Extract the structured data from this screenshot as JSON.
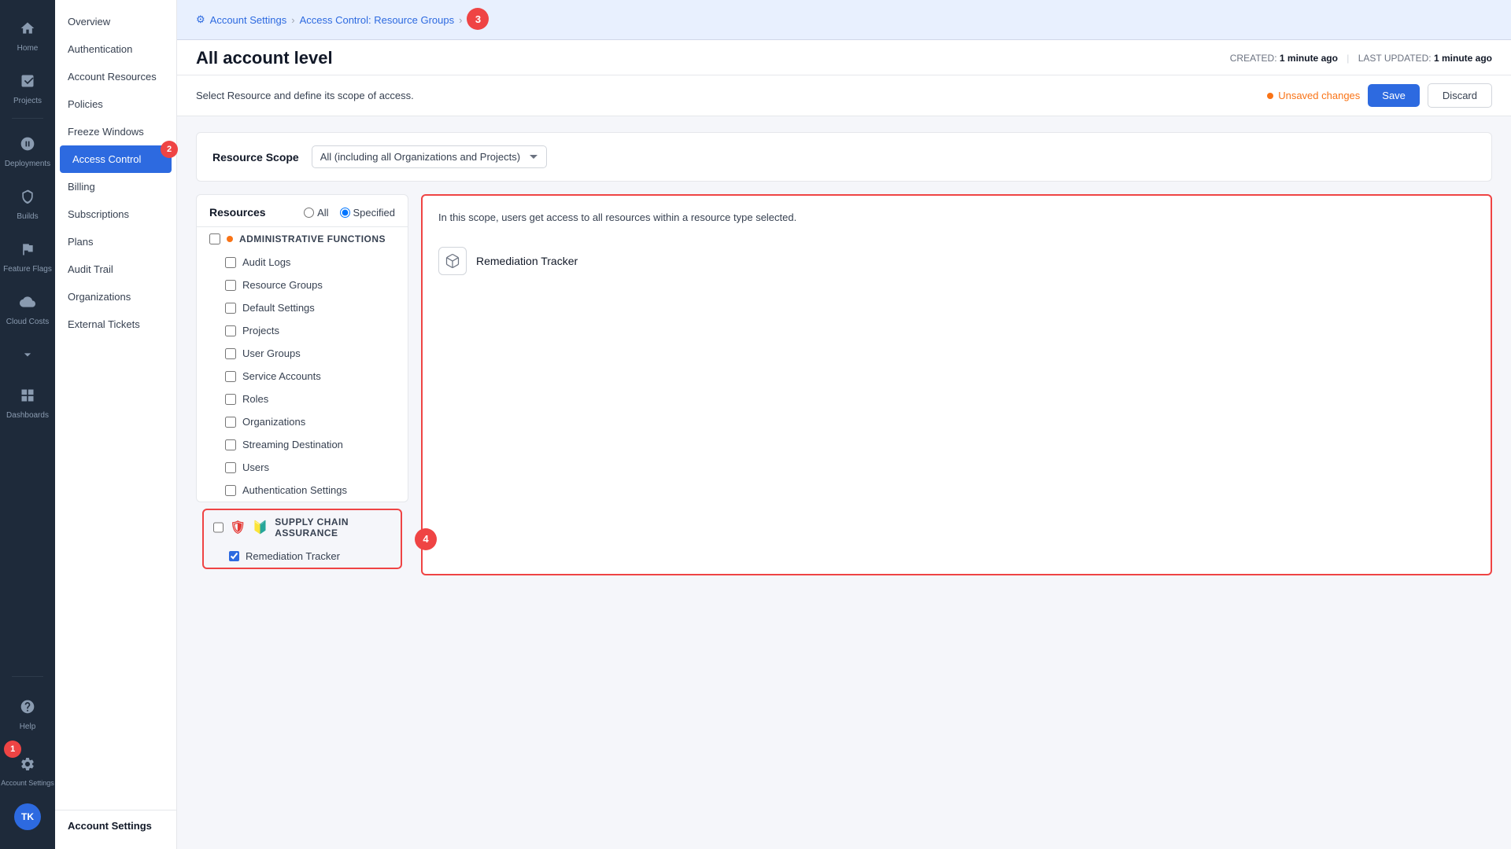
{
  "iconNav": {
    "items": [
      {
        "id": "home",
        "label": "Home",
        "icon": "home",
        "active": false
      },
      {
        "id": "projects",
        "label": "Projects",
        "icon": "projects",
        "active": false
      },
      {
        "id": "deployments",
        "label": "Deployments",
        "icon": "deployments",
        "active": false
      },
      {
        "id": "builds",
        "label": "Builds",
        "icon": "builds",
        "active": false
      },
      {
        "id": "feature-flags",
        "label": "Feature Flags",
        "icon": "flags",
        "active": false
      },
      {
        "id": "cloud-costs",
        "label": "Cloud Costs",
        "icon": "cloud",
        "active": false
      },
      {
        "id": "help",
        "label": "Help",
        "icon": "help",
        "active": false
      },
      {
        "id": "dashboards",
        "label": "Dashboards",
        "icon": "dashboards",
        "active": false
      },
      {
        "id": "account-settings",
        "label": "Account Settings",
        "icon": "gear",
        "active": false
      }
    ]
  },
  "sidebar": {
    "items": [
      {
        "label": "Overview",
        "active": false
      },
      {
        "label": "Authentication",
        "active": false
      },
      {
        "label": "Account Resources",
        "active": false
      },
      {
        "label": "Policies",
        "active": false
      },
      {
        "label": "Freeze Windows",
        "active": false
      },
      {
        "label": "Access Control",
        "active": true
      },
      {
        "label": "Billing",
        "active": false
      },
      {
        "label": "Subscriptions",
        "active": false
      },
      {
        "label": "Plans",
        "active": false
      },
      {
        "label": "Audit Trail",
        "active": false
      },
      {
        "label": "Organizations",
        "active": false
      },
      {
        "label": "External Tickets",
        "active": false
      }
    ],
    "accountTitle": "Account Settings"
  },
  "breadcrumb": {
    "settings": "Account Settings",
    "parent": "Access Control: Resource Groups",
    "current": "3"
  },
  "pageTitle": "All account level",
  "meta": {
    "created": "1 minute ago",
    "lastUpdated": "1 minute ago",
    "createdLabel": "CREATED:",
    "lastUpdatedLabel": "LAST UPDATED:"
  },
  "toolbar": {
    "description": "Select Resource and define its scope of access.",
    "unsavedLabel": "Unsaved changes",
    "saveLabel": "Save",
    "discardLabel": "Discard"
  },
  "resourceScope": {
    "label": "Resource Scope",
    "value": "All (including all Organizations and Projects)"
  },
  "resources": {
    "title": "Resources",
    "radioAll": "All",
    "radioSpecified": "Specified",
    "selectedRadio": "Specified",
    "category": "ADMINISTRATIVE FUNCTIONS",
    "items": [
      "Audit Logs",
      "Resource Groups",
      "Default Settings",
      "Projects",
      "User Groups",
      "Service Accounts",
      "Roles",
      "Organizations",
      "Streaming Destination",
      "Users",
      "Authentication Settings"
    ]
  },
  "supplyChain": {
    "title": "SUPPLY CHAIN ASSURANCE",
    "item": "Remediation Tracker",
    "checked": true
  },
  "scopeInfo": {
    "description": "In this scope, users get access to all resources within a resource type selected.",
    "resourceName": "Remediation Tracker"
  },
  "steps": {
    "s1": "1",
    "s2": "2",
    "s3": "3",
    "s4": "4"
  },
  "avatar": "TK"
}
